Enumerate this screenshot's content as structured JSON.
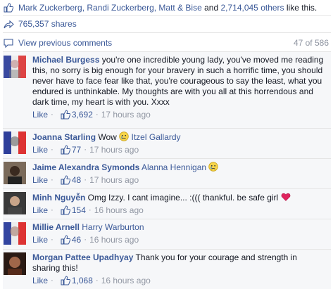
{
  "likes": {
    "names": "Mark Zuckerberg, Randi Zuckerberg, Matt & Bise",
    "and": " and ",
    "others": "2,714,045 others",
    "suffix": " like this."
  },
  "shares": {
    "label": "765,357 shares"
  },
  "previous": {
    "label": "View previous comments",
    "count": "47 of 586"
  },
  "colors": {
    "link": "#3b5998",
    "meta": "#9197a3",
    "comment_bg": "#f6f7f9"
  },
  "comments": [
    {
      "author": "Michael Burgess",
      "text": "you're one incredible young lady, you've moved me reading this, no sorry is big enough for your bravery in such a horrific time, you should never have to face fear like that, you're courageous to say the least, what you endured is unthinkable. My thoughts are with you all at this horrendous and dark time, my heart is with you. Xxxx",
      "like": "Like",
      "likes": "3,692",
      "time": "17 hours ago"
    },
    {
      "author": "Joanna Starling",
      "text": "Wow",
      "tag": "Itzel Gallardy",
      "like": "Like",
      "likes": "77",
      "time": "17 hours ago"
    },
    {
      "author": "Jaime Alexandra Symonds",
      "text": "",
      "tag": "Alanna Hennigan",
      "like": "Like",
      "likes": "48",
      "time": "17 hours ago"
    },
    {
      "author": "Minh Nguyễn",
      "text": "Omg Izzy. I cant imagine... :((( thankful. be safe girl",
      "like": "Like",
      "likes": "154",
      "time": "16 hours ago"
    },
    {
      "author": "Millie Arnell",
      "text": "",
      "tag": "Harry Warburton",
      "like": "Like",
      "likes": "46",
      "time": "16 hours ago"
    },
    {
      "author": "Morgan Pattee Upadhyay",
      "text": "Thank you for your courage and strength in sharing this!",
      "like": "Like",
      "likes": "1,068",
      "time": "16 hours ago"
    }
  ]
}
